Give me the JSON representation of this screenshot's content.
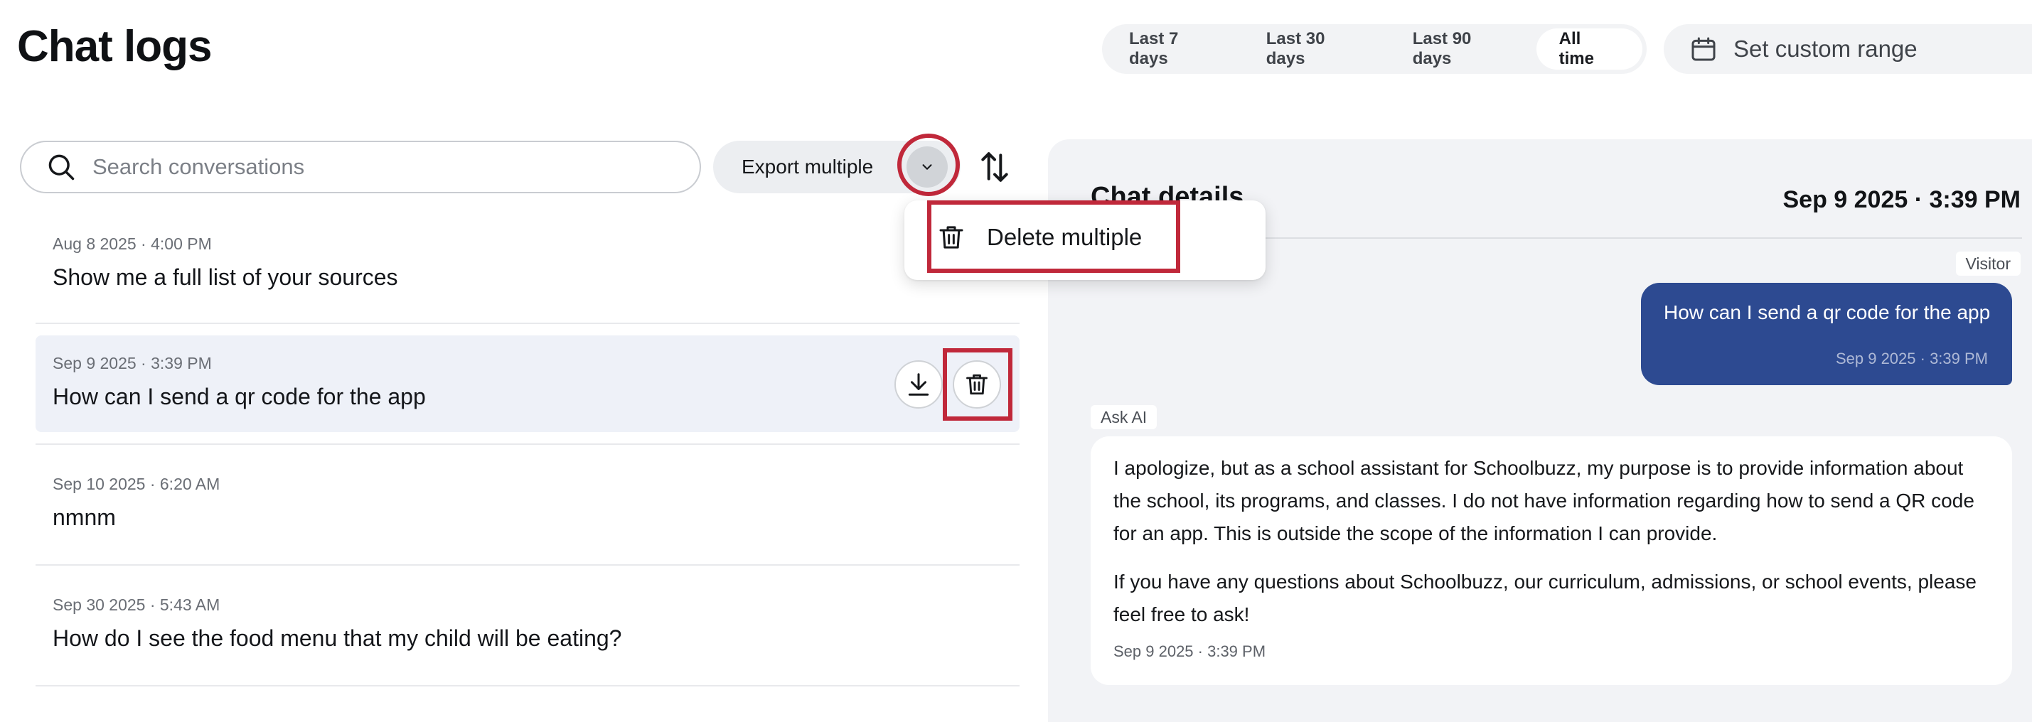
{
  "header": {
    "title": "Chat logs",
    "date_ranges": [
      {
        "label": "Last 7 days",
        "active": false
      },
      {
        "label": "Last 30 days",
        "active": false
      },
      {
        "label": "Last 90 days",
        "active": false
      },
      {
        "label": "All time",
        "active": true
      }
    ],
    "custom_range": {
      "label": "Set custom range",
      "icon": "calendar-icon"
    }
  },
  "toolbar": {
    "search_placeholder": "Search conversations",
    "search_value": "",
    "export_label": "Export multiple",
    "caret_icon": "chevron-down-icon",
    "sort_icon": "sort-arrows-icon"
  },
  "dropdown": {
    "items": [
      {
        "label": "Delete multiple",
        "icon": "trash-icon"
      }
    ]
  },
  "chat_list": {
    "items": [
      {
        "date": "Aug 8 2025 · 4:00 PM",
        "title": "Show me a full list of your sources"
      },
      {
        "date": "Sep 9 2025 · 3:39 PM",
        "title": "How can I send a qr code for the app",
        "selected": true
      },
      {
        "date": "Sep 10 2025 · 6:20 AM",
        "title": "nmnm"
      },
      {
        "date": "Sep 30 2025 · 5:43 AM",
        "title": "How do I see the food menu that my child will be eating?"
      }
    ],
    "row_actions": [
      "download-icon",
      "trash-icon"
    ]
  },
  "details": {
    "title": "Chat details",
    "timestamp": "Sep 9 2025 · 3:39 PM",
    "messages": [
      {
        "role": "Visitor",
        "text": "How can I send a qr code for the app",
        "time": "Sep 9 2025 · 3:39 PM"
      },
      {
        "role": "Ask AI",
        "paragraphs": [
          "I apologize, but as a school assistant for Schoolbuzz, my purpose is to provide information about the school, its programs, and classes. I do not have information regarding how to send a QR code for an app. This is outside the scope of the information I can provide.",
          "If you have any questions about Schoolbuzz, our curriculum, admissions, or school events, please feel free to ask!"
        ],
        "time": "Sep 9 2025 · 3:39 PM"
      }
    ]
  },
  "colors": {
    "highlight": "#c0283a",
    "visitor_bubble": "#2d4a91",
    "selected_row": "#eef1f8",
    "panel_bg": "#f2f3f6"
  }
}
